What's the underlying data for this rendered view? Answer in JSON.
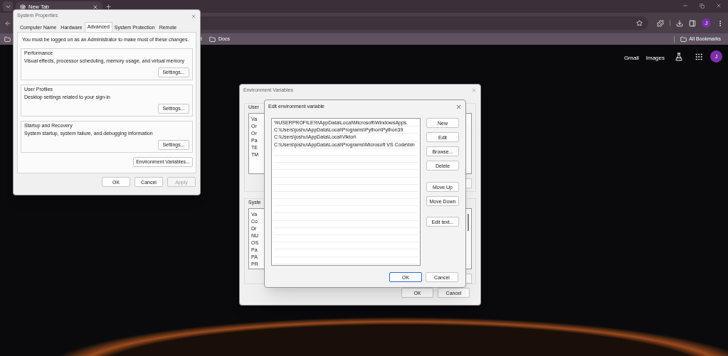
{
  "browser": {
    "tabs": [
      {
        "title": "New Tab",
        "selected": true
      }
    ],
    "bookmarks": [
      {
        "label": "t"
      },
      {
        "label": "Docs"
      }
    ],
    "all_bookmarks": "All Bookmarks",
    "profile_initial": "J"
  },
  "page": {
    "links": [
      "Gmail",
      "Images"
    ],
    "avatar": "J"
  },
  "system_properties": {
    "title": "System Properties",
    "tabs": [
      {
        "label": "Computer Name",
        "selected": false
      },
      {
        "label": "Hardware",
        "selected": false
      },
      {
        "label": "Advanced",
        "selected": true
      },
      {
        "label": "System Protection",
        "selected": false
      },
      {
        "label": "Remote",
        "selected": false
      }
    ],
    "notice": "You must be logged on as an Administrator to make most of these changes.",
    "groups": [
      {
        "title": "Performance",
        "description": "Visual effects, processor scheduling, memory usage, and virtual memory",
        "button": "Settings..."
      },
      {
        "title": "User Profiles",
        "description": "Desktop settings related to your sign-in",
        "button": "Settings..."
      },
      {
        "title": "Startup and Recovery",
        "description": "System startup, system failure, and debugging information",
        "button": "Settings..."
      }
    ],
    "env_button": "Environment Variables...",
    "buttons": [
      {
        "label": "OK",
        "disabled": false
      },
      {
        "label": "Cancel",
        "disabled": false
      },
      {
        "label": "Apply",
        "disabled": true
      }
    ]
  },
  "environment_variables": {
    "title": "Environment Variables",
    "user_label": "User",
    "user_rows": [
      "Va",
      "Or",
      "Or",
      "Pa",
      "TE",
      "TM"
    ],
    "system_label": "Syste",
    "system_rows": [
      "Va",
      "Co",
      "Dr",
      "NU",
      "OS",
      "Pa",
      "PA",
      "PR"
    ],
    "buttons": [
      "OK",
      "Cancel"
    ]
  },
  "edit_dialog": {
    "title": "Edit environment variable",
    "entries": [
      "%USERPROFILE%\\AppData\\Local\\Microsoft\\WindowsApps",
      "C:\\Users\\joshu\\AppData\\Local\\Programs\\Python\\Python39",
      "C:\\Users\\joshu\\AppData\\Local\\Viktor\\",
      "C:\\Users\\joshu\\AppData\\Local\\Programs\\Microsoft VS Code\\bin"
    ],
    "side_buttons": [
      "New",
      "Edit",
      "Browse...",
      "Delete",
      "Move Up",
      "Move Down",
      "Edit text..."
    ],
    "buttons": [
      {
        "label": "OK",
        "focused": true
      },
      {
        "label": "Cancel",
        "focused": false
      }
    ]
  }
}
